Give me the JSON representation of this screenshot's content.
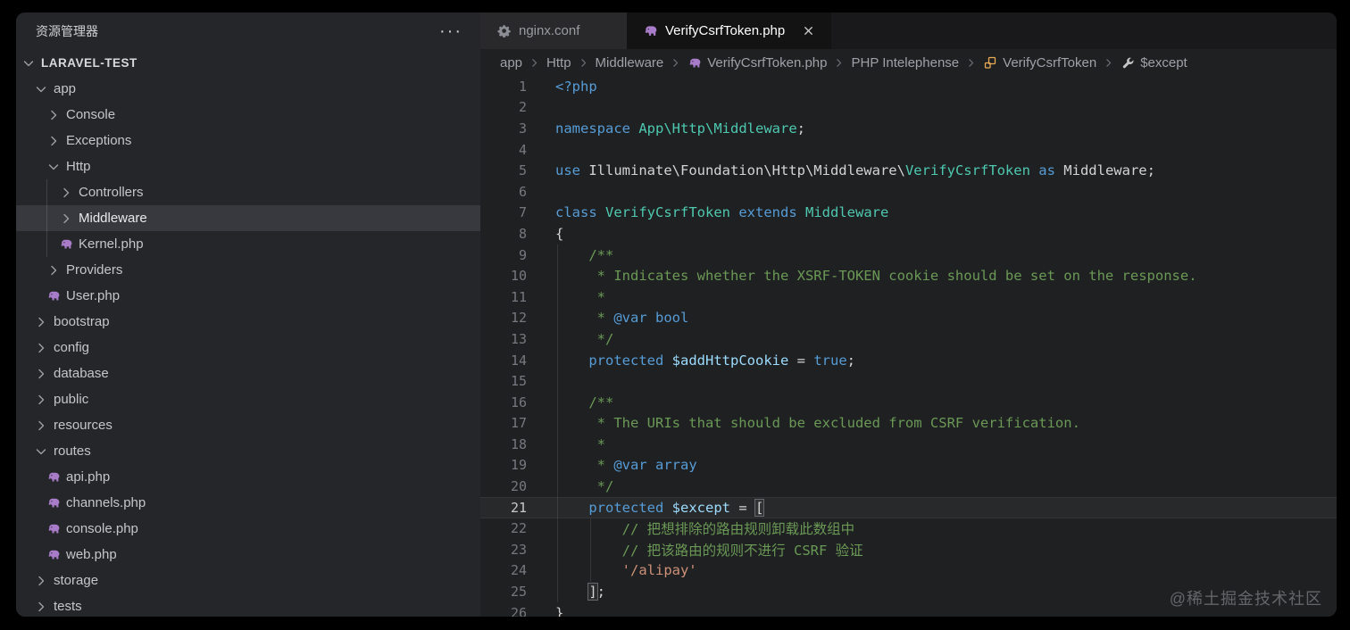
{
  "colors": {
    "bg": "#000000",
    "window": "#1f2022",
    "sidebar": "#252629",
    "sidebarSelected": "#37393e",
    "tabstrip": "#19191b",
    "tabInactive": "#29292c",
    "tabActive": "#131314",
    "kw": "#569CD6",
    "cls": "#4EC9B0",
    "cmt": "#6A9955",
    "doc": "#569CD6",
    "str": "#CE9178",
    "var": "#9CDCFE",
    "pun": "#D4D4D4",
    "phpIcon": "#A87CC9",
    "classIcon": "#E8AB53",
    "wrenchIcon": "#C5C5C5"
  },
  "sidebar": {
    "title": "资源管理器",
    "more_label": "···",
    "tree": [
      {
        "label": "LARAVEL-TEST",
        "level": 0,
        "type": "folder",
        "expanded": true,
        "root": true
      },
      {
        "label": "app",
        "level": 1,
        "type": "folder",
        "expanded": true
      },
      {
        "label": "Console",
        "level": 2,
        "type": "folder",
        "expanded": false
      },
      {
        "label": "Exceptions",
        "level": 2,
        "type": "folder",
        "expanded": false
      },
      {
        "label": "Http",
        "level": 2,
        "type": "folder",
        "expanded": true
      },
      {
        "label": "Controllers",
        "level": 3,
        "type": "folder",
        "expanded": false
      },
      {
        "label": "Middleware",
        "level": 3,
        "type": "folder",
        "expanded": false,
        "selected": true
      },
      {
        "label": "Kernel.php",
        "level": 3,
        "type": "file"
      },
      {
        "label": "Providers",
        "level": 2,
        "type": "folder",
        "expanded": false
      },
      {
        "label": "User.php",
        "level": 2,
        "type": "file"
      },
      {
        "label": "bootstrap",
        "level": 1,
        "type": "folder",
        "expanded": false
      },
      {
        "label": "config",
        "level": 1,
        "type": "folder",
        "expanded": false
      },
      {
        "label": "database",
        "level": 1,
        "type": "folder",
        "expanded": false
      },
      {
        "label": "public",
        "level": 1,
        "type": "folder",
        "expanded": false
      },
      {
        "label": "resources",
        "level": 1,
        "type": "folder",
        "expanded": false
      },
      {
        "label": "routes",
        "level": 1,
        "type": "folder",
        "expanded": true
      },
      {
        "label": "api.php",
        "level": 2,
        "type": "file"
      },
      {
        "label": "channels.php",
        "level": 2,
        "type": "file"
      },
      {
        "label": "console.php",
        "level": 2,
        "type": "file"
      },
      {
        "label": "web.php",
        "level": 2,
        "type": "file"
      },
      {
        "label": "storage",
        "level": 1,
        "type": "folder",
        "expanded": false
      },
      {
        "label": "tests",
        "level": 1,
        "type": "folder",
        "expanded": false
      }
    ]
  },
  "tabs": [
    {
      "label": "nginx.conf",
      "icon": "gear",
      "active": false,
      "closable": false
    },
    {
      "label": "VerifyCsrfToken.php",
      "icon": "php",
      "active": true,
      "closable": true
    }
  ],
  "breadcrumb": [
    {
      "label": "app"
    },
    {
      "label": "Http"
    },
    {
      "label": "Middleware"
    },
    {
      "label": "VerifyCsrfToken.php",
      "icon": "php"
    },
    {
      "label": "PHP Intelephense"
    },
    {
      "label": "VerifyCsrfToken",
      "icon": "class"
    },
    {
      "label": "$except",
      "icon": "wrench"
    }
  ],
  "editor": {
    "active_line": 21,
    "lines": [
      {
        "n": 1,
        "t": [
          [
            "kw",
            "<?php"
          ]
        ]
      },
      {
        "n": 2,
        "t": []
      },
      {
        "n": 3,
        "t": [
          [
            "kw",
            "namespace"
          ],
          [
            "pun",
            " "
          ],
          [
            "cls",
            "App\\Http\\Middleware"
          ],
          [
            "pun",
            ";"
          ]
        ]
      },
      {
        "n": 4,
        "t": []
      },
      {
        "n": 5,
        "t": [
          [
            "kw",
            "use"
          ],
          [
            "pun",
            " Illuminate\\Foundation\\Http\\Middleware\\"
          ],
          [
            "cls",
            "VerifyCsrfToken"
          ],
          [
            "pun",
            " "
          ],
          [
            "kw",
            "as"
          ],
          [
            "pun",
            " Middleware;"
          ]
        ]
      },
      {
        "n": 6,
        "t": []
      },
      {
        "n": 7,
        "t": [
          [
            "kw",
            "class"
          ],
          [
            "pun",
            " "
          ],
          [
            "cls",
            "VerifyCsrfToken"
          ],
          [
            "pun",
            " "
          ],
          [
            "kw",
            "extends"
          ],
          [
            "pun",
            " "
          ],
          [
            "cls",
            "Middleware"
          ]
        ]
      },
      {
        "n": 8,
        "t": [
          [
            "pun",
            "{"
          ]
        ]
      },
      {
        "n": 9,
        "t": [
          [
            "cmt",
            "    /**"
          ]
        ]
      },
      {
        "n": 10,
        "t": [
          [
            "cmt",
            "     * Indicates whether the XSRF-TOKEN cookie should be set on the response."
          ]
        ]
      },
      {
        "n": 11,
        "t": [
          [
            "cmt",
            "     *"
          ]
        ]
      },
      {
        "n": 12,
        "t": [
          [
            "cmt",
            "     * "
          ],
          [
            "doc",
            "@var bool"
          ]
        ]
      },
      {
        "n": 13,
        "t": [
          [
            "cmt",
            "     */"
          ]
        ]
      },
      {
        "n": 14,
        "t": [
          [
            "pun",
            "    "
          ],
          [
            "kw",
            "protected"
          ],
          [
            "pun",
            " "
          ],
          [
            "var",
            "$addHttpCookie"
          ],
          [
            "pun",
            " = "
          ],
          [
            "kw",
            "true"
          ],
          [
            "pun",
            ";"
          ]
        ]
      },
      {
        "n": 15,
        "t": []
      },
      {
        "n": 16,
        "t": [
          [
            "cmt",
            "    /**"
          ]
        ]
      },
      {
        "n": 17,
        "t": [
          [
            "cmt",
            "     * The URIs that should be excluded from CSRF verification."
          ]
        ]
      },
      {
        "n": 18,
        "t": [
          [
            "cmt",
            "     *"
          ]
        ]
      },
      {
        "n": 19,
        "t": [
          [
            "cmt",
            "     * "
          ],
          [
            "doc",
            "@var array"
          ]
        ]
      },
      {
        "n": 20,
        "t": [
          [
            "cmt",
            "     */"
          ]
        ]
      },
      {
        "n": 21,
        "t": [
          [
            "pun",
            "    "
          ],
          [
            "kw",
            "protected"
          ],
          [
            "pun",
            " "
          ],
          [
            "var",
            "$except"
          ],
          [
            "pun",
            " = "
          ],
          [
            "brk",
            "["
          ]
        ]
      },
      {
        "n": 22,
        "t": [
          [
            "cmt",
            "        // 把想排除的路由规则卸载此数组中"
          ]
        ]
      },
      {
        "n": 23,
        "t": [
          [
            "cmt",
            "        // 把该路由的规则不进行 CSRF 验证"
          ]
        ]
      },
      {
        "n": 24,
        "t": [
          [
            "pun",
            "        "
          ],
          [
            "str",
            "'/alipay'"
          ]
        ]
      },
      {
        "n": 25,
        "t": [
          [
            "pun",
            "    "
          ],
          [
            "brk",
            "]"
          ],
          [
            "pun",
            ";"
          ]
        ]
      },
      {
        "n": 26,
        "t": [
          [
            "pun",
            "}"
          ]
        ]
      }
    ]
  },
  "watermark": "@稀土掘金技术社区"
}
